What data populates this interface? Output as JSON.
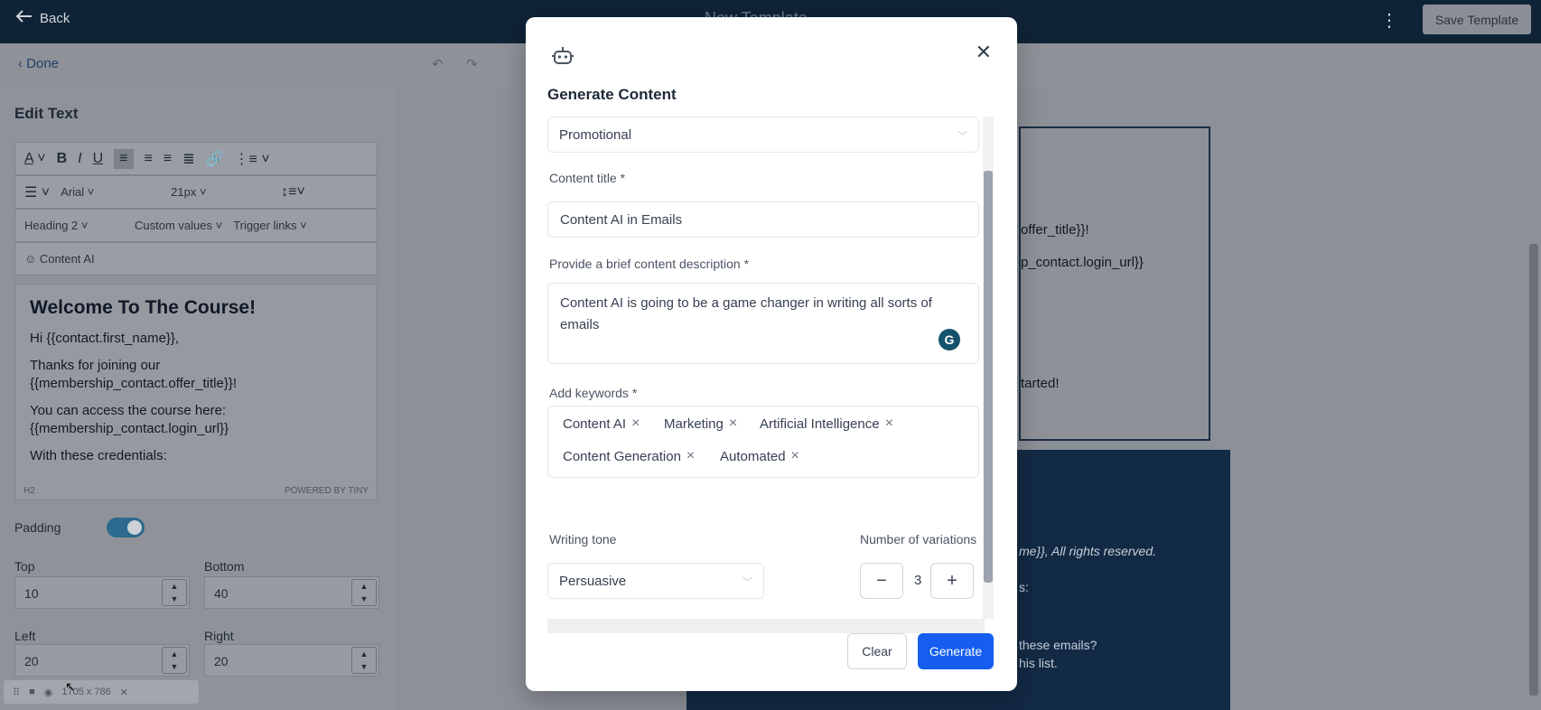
{
  "topbar": {
    "back_label": "Back",
    "template_title": "New Template",
    "save_label": "Save Template"
  },
  "editor": {
    "done_label": "Done",
    "panel_title": "Edit Text",
    "font_family": "Arial",
    "font_size": "21px",
    "block_type": "Heading 2",
    "custom_values_label": "Custom values",
    "trigger_links_label": "Trigger links",
    "content_ai_label": "Content AI",
    "content": {
      "heading": "Welcome To The Course!",
      "greeting": "Hi {{contact.first_name}},",
      "p1": "Thanks for joining our {{membership_contact.offer_title}}!",
      "p2": "You can access the course here: {{membership_contact.login_url}}",
      "p3": "With these credentials:"
    },
    "status_left": "H2",
    "status_right": "POWERED BY TINY",
    "padding_label": "Padding",
    "top_label": "Top",
    "top_value": "10",
    "bottom_label": "Bottom",
    "bottom_value": "40",
    "left_label": "Left",
    "left_value": "20",
    "right_label": "Right",
    "right_value": "20",
    "screen_size": "1705 x 786"
  },
  "preview": {
    "line1": "offer_title}}!",
    "line2": "p_contact.login_url}}",
    "line3": "tarted!",
    "footer_1": "me}}, All rights reserved.",
    "footer_2": "s:",
    "footer_3": "these emails?",
    "footer_4": "his list."
  },
  "modal": {
    "title": "Generate Content",
    "content_type": "Promotional",
    "content_title_label": "Content title *",
    "content_title_value": "Content AI in Emails",
    "description_label": "Provide a brief content description *",
    "description_value": "Content AI is going to be a game changer in writing all sorts of emails",
    "keywords_label": "Add keywords *",
    "keywords": [
      "Content AI",
      "Marketing",
      "Artificial Intelligence",
      "Content Generation",
      "Automated"
    ],
    "tone_label": "Writing tone",
    "tone_value": "Persuasive",
    "variations_label": "Number of variations",
    "variations_value": "3",
    "clear_label": "Clear",
    "generate_label": "Generate"
  }
}
